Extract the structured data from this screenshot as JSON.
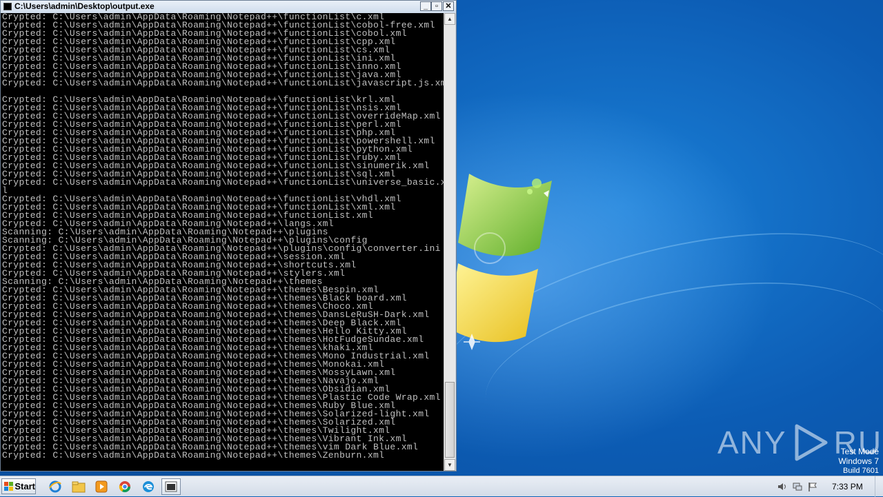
{
  "window": {
    "title": "C:\\Users\\admin\\Desktop\\output.exe",
    "minimize_glyph": "_",
    "maximize_glyph": "▫",
    "close_glyph": "✕"
  },
  "console": {
    "lines": [
      "Crypted: C:\\Users\\admin\\AppData\\Roaming\\Notepad++\\functionList\\c.xml",
      "Crypted: C:\\Users\\admin\\AppData\\Roaming\\Notepad++\\functionList\\cobol-free.xml",
      "Crypted: C:\\Users\\admin\\AppData\\Roaming\\Notepad++\\functionList\\cobol.xml",
      "Crypted: C:\\Users\\admin\\AppData\\Roaming\\Notepad++\\functionList\\cpp.xml",
      "Crypted: C:\\Users\\admin\\AppData\\Roaming\\Notepad++\\functionList\\cs.xml",
      "Crypted: C:\\Users\\admin\\AppData\\Roaming\\Notepad++\\functionList\\ini.xml",
      "Crypted: C:\\Users\\admin\\AppData\\Roaming\\Notepad++\\functionList\\inno.xml",
      "Crypted: C:\\Users\\admin\\AppData\\Roaming\\Notepad++\\functionList\\java.xml",
      "Crypted: C:\\Users\\admin\\AppData\\Roaming\\Notepad++\\functionList\\javascript.js.xml",
      "",
      "Crypted: C:\\Users\\admin\\AppData\\Roaming\\Notepad++\\functionList\\krl.xml",
      "Crypted: C:\\Users\\admin\\AppData\\Roaming\\Notepad++\\functionList\\nsis.xml",
      "Crypted: C:\\Users\\admin\\AppData\\Roaming\\Notepad++\\functionList\\overrideMap.xml",
      "Crypted: C:\\Users\\admin\\AppData\\Roaming\\Notepad++\\functionList\\perl.xml",
      "Crypted: C:\\Users\\admin\\AppData\\Roaming\\Notepad++\\functionList\\php.xml",
      "Crypted: C:\\Users\\admin\\AppData\\Roaming\\Notepad++\\functionList\\powershell.xml",
      "Crypted: C:\\Users\\admin\\AppData\\Roaming\\Notepad++\\functionList\\python.xml",
      "Crypted: C:\\Users\\admin\\AppData\\Roaming\\Notepad++\\functionList\\ruby.xml",
      "Crypted: C:\\Users\\admin\\AppData\\Roaming\\Notepad++\\functionList\\sinumerik.xml",
      "Crypted: C:\\Users\\admin\\AppData\\Roaming\\Notepad++\\functionList\\sql.xml",
      "Crypted: C:\\Users\\admin\\AppData\\Roaming\\Notepad++\\functionList\\universe_basic.xm",
      "l",
      "Crypted: C:\\Users\\admin\\AppData\\Roaming\\Notepad++\\functionList\\vhdl.xml",
      "Crypted: C:\\Users\\admin\\AppData\\Roaming\\Notepad++\\functionList\\xml.xml",
      "Crypted: C:\\Users\\admin\\AppData\\Roaming\\Notepad++\\functionList.xml",
      "Crypted: C:\\Users\\admin\\AppData\\Roaming\\Notepad++\\langs.xml",
      "Scanning: C:\\Users\\admin\\AppData\\Roaming\\Notepad++\\plugins",
      "Scanning: C:\\Users\\admin\\AppData\\Roaming\\Notepad++\\plugins\\config",
      "Crypted: C:\\Users\\admin\\AppData\\Roaming\\Notepad++\\plugins\\config\\converter.ini",
      "Crypted: C:\\Users\\admin\\AppData\\Roaming\\Notepad++\\session.xml",
      "Crypted: C:\\Users\\admin\\AppData\\Roaming\\Notepad++\\shortcuts.xml",
      "Crypted: C:\\Users\\admin\\AppData\\Roaming\\Notepad++\\stylers.xml",
      "Scanning: C:\\Users\\admin\\AppData\\Roaming\\Notepad++\\themes",
      "Crypted: C:\\Users\\admin\\AppData\\Roaming\\Notepad++\\themes\\Bespin.xml",
      "Crypted: C:\\Users\\admin\\AppData\\Roaming\\Notepad++\\themes\\Black board.xml",
      "Crypted: C:\\Users\\admin\\AppData\\Roaming\\Notepad++\\themes\\Choco.xml",
      "Crypted: C:\\Users\\admin\\AppData\\Roaming\\Notepad++\\themes\\DansLeRuSH-Dark.xml",
      "Crypted: C:\\Users\\admin\\AppData\\Roaming\\Notepad++\\themes\\Deep Black.xml",
      "Crypted: C:\\Users\\admin\\AppData\\Roaming\\Notepad++\\themes\\Hello Kitty.xml",
      "Crypted: C:\\Users\\admin\\AppData\\Roaming\\Notepad++\\themes\\HotFudgeSundae.xml",
      "Crypted: C:\\Users\\admin\\AppData\\Roaming\\Notepad++\\themes\\khaki.xml",
      "Crypted: C:\\Users\\admin\\AppData\\Roaming\\Notepad++\\themes\\Mono Industrial.xml",
      "Crypted: C:\\Users\\admin\\AppData\\Roaming\\Notepad++\\themes\\Monokai.xml",
      "Crypted: C:\\Users\\admin\\AppData\\Roaming\\Notepad++\\themes\\MossyLawn.xml",
      "Crypted: C:\\Users\\admin\\AppData\\Roaming\\Notepad++\\themes\\Navajo.xml",
      "Crypted: C:\\Users\\admin\\AppData\\Roaming\\Notepad++\\themes\\Obsidian.xml",
      "Crypted: C:\\Users\\admin\\AppData\\Roaming\\Notepad++\\themes\\Plastic Code Wrap.xml",
      "Crypted: C:\\Users\\admin\\AppData\\Roaming\\Notepad++\\themes\\Ruby Blue.xml",
      "Crypted: C:\\Users\\admin\\AppData\\Roaming\\Notepad++\\themes\\Solarized-light.xml",
      "Crypted: C:\\Users\\admin\\AppData\\Roaming\\Notepad++\\themes\\Solarized.xml",
      "Crypted: C:\\Users\\admin\\AppData\\Roaming\\Notepad++\\themes\\Twilight.xml",
      "Crypted: C:\\Users\\admin\\AppData\\Roaming\\Notepad++\\themes\\Vibrant Ink.xml",
      "Crypted: C:\\Users\\admin\\AppData\\Roaming\\Notepad++\\themes\\vim Dark Blue.xml",
      "Crypted: C:\\Users\\admin\\AppData\\Roaming\\Notepad++\\themes\\Zenburn.xml"
    ]
  },
  "watermark": {
    "left_text": "ANY",
    "right_text": "RUN"
  },
  "system_info": {
    "line1": "Test Mode",
    "line2": "Windows 7",
    "line3": "Build 7601"
  },
  "taskbar": {
    "start_label": "Start",
    "apps": [
      {
        "icon": "internet-explorer-icon"
      },
      {
        "icon": "file-explorer-icon"
      },
      {
        "icon": "media-player-icon"
      },
      {
        "icon": "chrome-icon"
      },
      {
        "icon": "edge-icon"
      },
      {
        "icon": "console-app-icon"
      }
    ],
    "clock": "7:33 PM"
  },
  "colors": {
    "console_bg": "#000000",
    "console_text": "#c0c0c0",
    "desktop_blue": "#0f63b8"
  }
}
